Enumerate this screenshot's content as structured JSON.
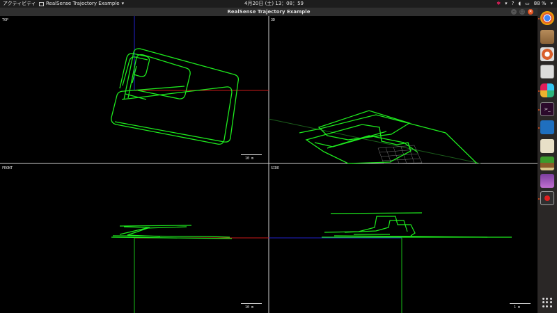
{
  "topbar": {
    "activities": "アクティビティ",
    "app_name": "RealSense Trajectory Example",
    "app_caret": "▾",
    "clock": "4月20日 (土) 13：08：59",
    "battery": "88 %",
    "tray_caret": "▾"
  },
  "window": {
    "title": "RealSense Trajectory Example",
    "minimize": "–",
    "maximize": "□",
    "close": "✕"
  },
  "views": {
    "top": {
      "label": "TOP",
      "scale": "10 m"
    },
    "3d": {
      "label": "3D"
    },
    "front": {
      "label": "FRONT",
      "scale": "10 m"
    },
    "side": {
      "label": "SIDE",
      "scale": "1 m"
    }
  },
  "colors": {
    "trajectory": "#1eea1e",
    "axis_x": "#cc1a1a",
    "axis_y": "#19c019",
    "axis_z": "#2222cc",
    "divider": "#cfcfcf",
    "grid": "#7a7a7a"
  },
  "dock": {
    "icons": [
      "chrome-icon",
      "files-icon",
      "settings-icon",
      "calculator-icon",
      "slack-icon",
      "terminal-icon",
      "vscode-icon",
      "document-icon",
      "palm-tree-icon",
      "image-viewer-icon",
      "screen-recorder-icon",
      "show-apps-icon"
    ]
  }
}
